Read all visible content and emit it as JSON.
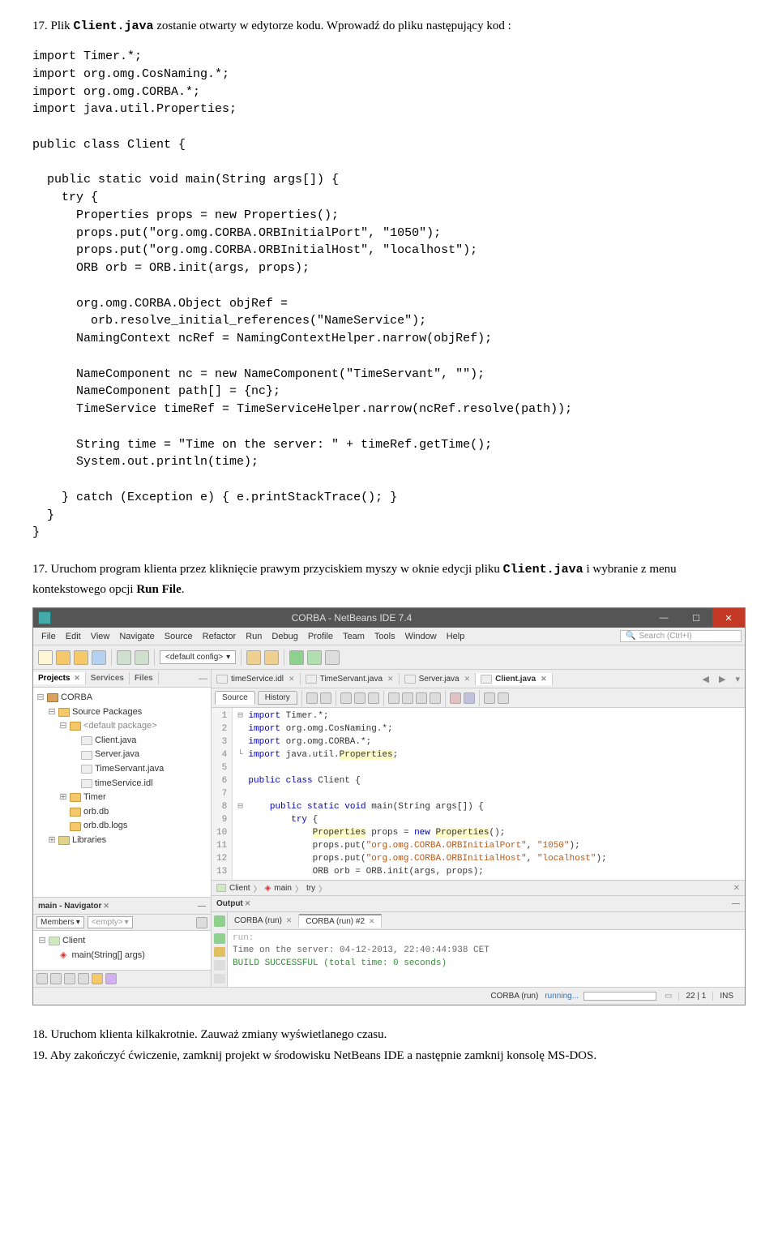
{
  "instr_17": {
    "prefix": "17. Plik ",
    "file": "Client.java",
    "mid": " zostanie otwarty w edytorze kodu. Wprowadź do pliku następujący kod :"
  },
  "code": "import Timer.*;\nimport org.omg.CosNaming.*;\nimport org.omg.CORBA.*;\nimport java.util.Properties;\n\npublic class Client {\n\n  public static void main(String args[]) {\n    try {\n      Properties props = new Properties();\n      props.put(\"org.omg.CORBA.ORBInitialPort\", \"1050\");\n      props.put(\"org.omg.CORBA.ORBInitialHost\", \"localhost\");\n      ORB orb = ORB.init(args, props);\n\n      org.omg.CORBA.Object objRef =\n        orb.resolve_initial_references(\"NameService\");\n      NamingContext ncRef = NamingContextHelper.narrow(objRef);\n\n      NameComponent nc = new NameComponent(\"TimeServant\", \"\");\n      NameComponent path[] = {nc};\n      TimeService timeRef = TimeServiceHelper.narrow(ncRef.resolve(path));\n\n      String time = \"Time on the server: \" + timeRef.getTime();\n      System.out.println(time);\n\n    } catch (Exception e) { e.printStackTrace(); }\n  }\n}",
  "instr_17b": {
    "text": "17. Uruchom program klienta przez kliknięcie prawym przyciskiem myszy w oknie edycji pliku ",
    "file": "Client.java",
    "mid": " i wybranie z menu kontekstowego opcji ",
    "opt": "Run File",
    "end": "."
  },
  "ide": {
    "title": "CORBA - NetBeans IDE 7.4",
    "menu": [
      "File",
      "Edit",
      "View",
      "Navigate",
      "Source",
      "Refactor",
      "Run",
      "Debug",
      "Profile",
      "Team",
      "Tools",
      "Window",
      "Help"
    ],
    "search_placeholder": "Search (Ctrl+I)",
    "config": "<default config>",
    "panels": {
      "projects": "Projects",
      "services": "Services",
      "files": "Files"
    },
    "tree": {
      "root": "CORBA",
      "src": "Source Packages",
      "pkg": "<default package>",
      "files": [
        "Client.java",
        "Server.java",
        "TimeServant.java",
        "timeService.idl"
      ],
      "timer": "Timer",
      "orbdb": "orb.db",
      "orbdblogs": "orb.db.logs",
      "libs": "Libraries"
    },
    "navigator": {
      "title": "main - Navigator",
      "view": "Members",
      "empty": "<empty>",
      "class": "Client",
      "method": "main(String[] args)"
    },
    "editor_tabs": [
      "timeService.idl",
      "TimeServant.java",
      "Server.java",
      "Client.java"
    ],
    "subtabs": [
      "Source",
      "History"
    ],
    "lines": {
      "1": "import Timer.*;",
      "2": "import org.omg.CosNaming.*;",
      "3": "import org.omg.CORBA.*;",
      "4_pre": "import java.util.",
      "4_hl": "Properties",
      "4_post": ";",
      "6": "public class Client {",
      "8": "    public static void main(String args[]) {",
      "9": "        try {",
      "10_a": "            ",
      "10_hl": "Properties",
      "10_b": " props = new ",
      "10_hl2": "Properties",
      "10_c": "();",
      "11_a": "            props.put(",
      "11_s1": "\"org.omg.CORBA.ORBInitialPort\"",
      "11_m": ", ",
      "11_s2": "\"1050\"",
      "11_e": ");",
      "12_a": "            props.put(",
      "12_s1": "\"org.omg.CORBA.ORBInitialHost\"",
      "12_m": ", ",
      "12_s2": "\"localhost\"",
      "12_e": ");",
      "13": "            ORB orb = ORB.init(args, props);"
    },
    "breadcrumb": [
      "Client",
      "main",
      "try"
    ],
    "output": {
      "title": "Output",
      "tabs": [
        "CORBA (run)",
        "CORBA (run) #2"
      ],
      "run_label": "run:",
      "line": "Time on the server: 04-12-2013, 22:40:44:938 CET",
      "build": "BUILD SUCCESSFUL (total time: 0 seconds)"
    },
    "status": {
      "task": "CORBA (run)",
      "state": "running...",
      "pos": "22 | 1",
      "ins": "INS"
    }
  },
  "instr_18": "18. Uruchom klienta kilkakrotnie. Zauważ zmiany wyświetlanego czasu.",
  "instr_19": "19. Aby zakończyć ćwiczenie, zamknij projekt w środowisku NetBeans IDE a następnie zamknij konsolę MS-DOS."
}
